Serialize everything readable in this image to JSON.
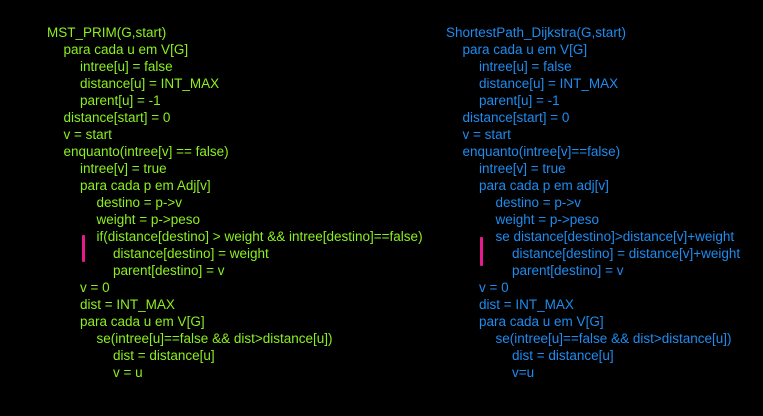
{
  "colors": {
    "background": "#000000",
    "prim_text": "#8cf01e",
    "dijkstra_text": "#1e8cf0",
    "marker": "#e8188f"
  },
  "prim": {
    "lines": [
      {
        "indent": 0,
        "text": "MST_PRIM(G,start)"
      },
      {
        "indent": 1,
        "text": "para cada u em V[G]"
      },
      {
        "indent": 2,
        "text": "intree[u] = false"
      },
      {
        "indent": 2,
        "text": "distance[u] = INT_MAX"
      },
      {
        "indent": 2,
        "text": "parent[u] = -1"
      },
      {
        "indent": 1,
        "text": "distance[start] = 0"
      },
      {
        "indent": 1,
        "text": "v = start"
      },
      {
        "indent": 1,
        "text": "enquanto(intree[v] == false)"
      },
      {
        "indent": 2,
        "text": "intree[v] = true"
      },
      {
        "indent": 2,
        "text": "para cada p em Adj[v]"
      },
      {
        "indent": 3,
        "text": "destino = p->v"
      },
      {
        "indent": 3,
        "text": "weight = p->peso"
      },
      {
        "indent": 3,
        "text": "if(distance[destino] > weight && intree[destino]==false)"
      },
      {
        "indent": 4,
        "text": "distance[destino] = weight"
      },
      {
        "indent": 4,
        "text": "parent[destino] = v"
      },
      {
        "indent": 2,
        "text": "v = 0"
      },
      {
        "indent": 2,
        "text": "dist = INT_MAX"
      },
      {
        "indent": 2,
        "text": "para cada u em V[G]"
      },
      {
        "indent": 3,
        "text": "se(intree[u]==false && dist>distance[u])"
      },
      {
        "indent": 4,
        "text": "dist = distance[u]"
      },
      {
        "indent": 4,
        "text": "v = u"
      }
    ]
  },
  "dijkstra": {
    "lines": [
      {
        "indent": 0,
        "text": "ShortestPath_Dijkstra(G,start)"
      },
      {
        "indent": 1,
        "text": "para cada u em V[G]"
      },
      {
        "indent": 2,
        "text": "intree[u] = false"
      },
      {
        "indent": 2,
        "text": "distance[u] = INT_MAX"
      },
      {
        "indent": 2,
        "text": "parent[u] = -1"
      },
      {
        "indent": 1,
        "text": "distance[start] = 0"
      },
      {
        "indent": 1,
        "text": "v = start"
      },
      {
        "indent": 1,
        "text": "enquanto(intree[v]==false)"
      },
      {
        "indent": 2,
        "text": "intree[v] = true"
      },
      {
        "indent": 2,
        "text": "para cada p em adj[v]"
      },
      {
        "indent": 3,
        "text": "destino = p->v"
      },
      {
        "indent": 3,
        "text": "weight = p->peso"
      },
      {
        "indent": 3,
        "text": "se distance[destino]>distance[v]+weight"
      },
      {
        "indent": 4,
        "text": "distance[destino] = distance[v]+weight"
      },
      {
        "indent": 4,
        "text": "parent[destino] = v"
      },
      {
        "indent": 2,
        "text": "v = 0"
      },
      {
        "indent": 2,
        "text": "dist = INT_MAX"
      },
      {
        "indent": 2,
        "text": "para cada u em V[G]"
      },
      {
        "indent": 3,
        "text": "se(intree[u]==false && dist>distance[u])"
      },
      {
        "indent": 4,
        "text": "dist = distance[u]"
      },
      {
        "indent": 4,
        "text": "v=u"
      }
    ]
  }
}
